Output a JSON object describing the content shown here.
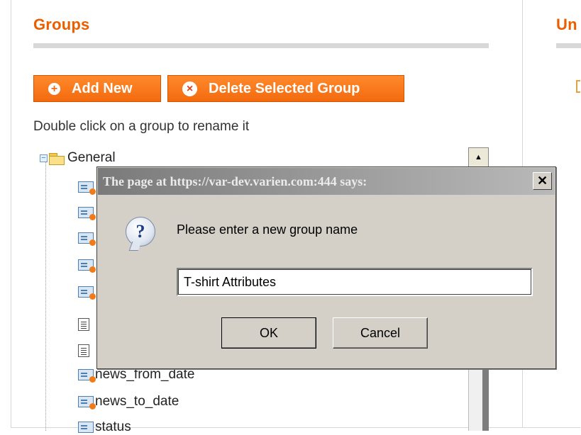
{
  "groups_title": "Groups",
  "right_title": "Un",
  "buttons": {
    "add_new": "Add New",
    "delete_group": "Delete Selected Group"
  },
  "hint": "Double click on a group to rename it",
  "tree": {
    "root": "General",
    "items": [
      "news_from_date",
      "news_to_date",
      "status"
    ]
  },
  "dialog": {
    "title": "The page at https://var-dev.varien.com:444 says:",
    "close": "✕",
    "prompt": "Please enter a new group name",
    "input_value": "T-shirt Attributes",
    "ok": "OK",
    "cancel": "Cancel"
  },
  "colors": {
    "accent": "#eb5e00",
    "dialog_bg": "#d4d0c8"
  },
  "icons": [
    "plus-circle-icon",
    "x-circle-icon",
    "folder-icon",
    "attribute-icon",
    "text-attribute-icon",
    "question-icon"
  ]
}
